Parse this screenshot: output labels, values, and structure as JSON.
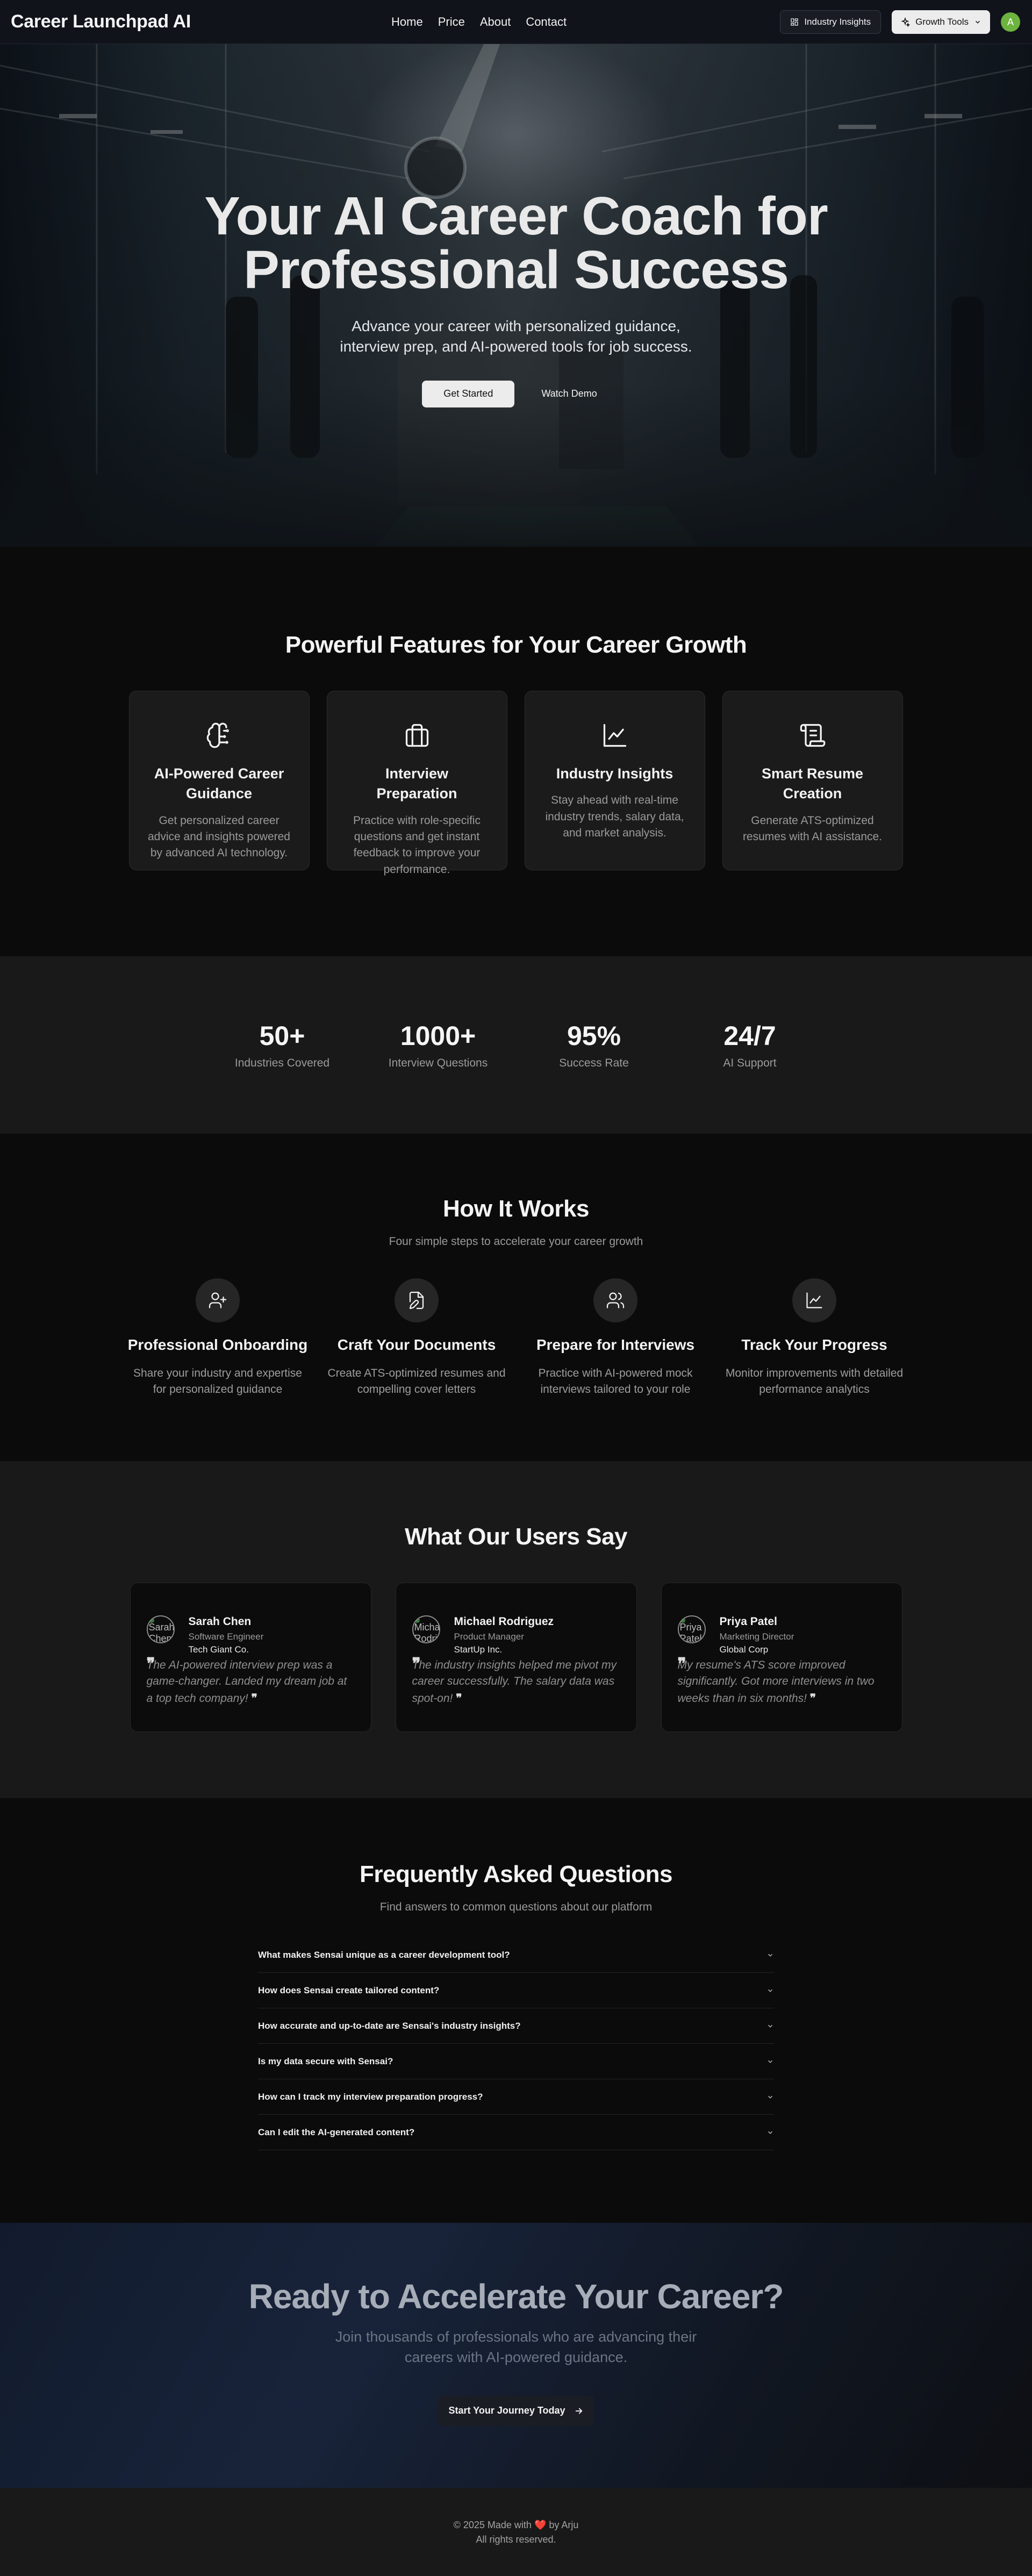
{
  "nav": {
    "brand": "Career Launchpad AI",
    "links": [
      "Home",
      "Price",
      "About",
      "Contact"
    ],
    "insights_label": "Industry Insights",
    "growth_label": "Growth Tools",
    "avatar_initial": "A"
  },
  "hero": {
    "title_line1": "Your AI Career Coach for",
    "title_line2": "Professional Success",
    "subtitle": "Advance your career with personalized guidance, interview prep, and AI-powered tools for job success.",
    "primary_button": "Get Started",
    "secondary_button": "Watch Demo"
  },
  "features": {
    "title": "Powerful Features for Your Career Growth",
    "items": [
      {
        "icon": "brain-icon",
        "title": "AI-Powered Career Guidance",
        "desc": "Get personalized career advice and insights powered by advanced AI technology."
      },
      {
        "icon": "briefcase-icon",
        "title": "Interview Preparation",
        "desc": "Practice with role-specific questions and get instant feedback to improve your performance."
      },
      {
        "icon": "line-chart-icon",
        "title": "Industry Insights",
        "desc": "Stay ahead with real-time industry trends, salary data, and market analysis."
      },
      {
        "icon": "scroll-icon",
        "title": "Smart Resume Creation",
        "desc": "Generate ATS-optimized resumes with AI assistance."
      }
    ]
  },
  "stats": [
    {
      "value": "50+",
      "label": "Industries Covered"
    },
    {
      "value": "1000+",
      "label": "Interview Questions"
    },
    {
      "value": "95%",
      "label": "Success Rate"
    },
    {
      "value": "24/7",
      "label": "AI Support"
    }
  ],
  "how": {
    "title": "How It Works",
    "subtitle": "Four simple steps to accelerate your career growth",
    "steps": [
      {
        "icon": "user-plus-icon",
        "title": "Professional Onboarding",
        "desc": "Share your industry and expertise for personalized guidance"
      },
      {
        "icon": "file-edit-icon",
        "title": "Craft Your Documents",
        "desc": "Create ATS-optimized resumes and compelling cover letters"
      },
      {
        "icon": "users-icon",
        "title": "Prepare for Interviews",
        "desc": "Practice with AI-powered mock interviews tailored to your role"
      },
      {
        "icon": "line-chart-icon",
        "title": "Track Your Progress",
        "desc": "Monitor improvements with detailed performance analytics"
      }
    ]
  },
  "testimonials": {
    "title": "What Our Users Say",
    "items": [
      {
        "photo_alt": "Sarah Chen",
        "name": "Sarah Chen",
        "role": "Software Engineer",
        "company": "Tech Giant Co.",
        "quote": "The AI-powered interview prep was a game-changer. Landed my dream job at a top tech company!"
      },
      {
        "photo_alt": "Michael Rodriguez",
        "name": "Michael Rodriguez",
        "role": "Product Manager",
        "company": "StartUp Inc.",
        "quote": "The industry insights helped me pivot my career successfully. The salary data was spot-on!"
      },
      {
        "photo_alt": "Priya Patel",
        "name": "Priya Patel",
        "role": "Marketing Director",
        "company": "Global Corp",
        "quote": "My resume's ATS score improved significantly. Got more interviews in two weeks than in six months!"
      }
    ]
  },
  "faq": {
    "title": "Frequently Asked Questions",
    "subtitle": "Find answers to common questions about our platform",
    "items": [
      "What makes Sensai unique as a career development tool?",
      "How does Sensai create tailored content?",
      "How accurate and up-to-date are Sensai's industry insights?",
      "Is my data secure with Sensai?",
      "How can I track my interview preparation progress?",
      "Can I edit the AI-generated content?"
    ]
  },
  "cta": {
    "title": "Ready to Accelerate Your Career?",
    "subtitle": "Join thousands of professionals who are advancing their careers with AI-powered guidance.",
    "button": "Start Your Journey Today"
  },
  "footer": {
    "line1_pre": "© 2025 Made with",
    "line1_post": "by Arju",
    "line2": "All rights reserved."
  }
}
